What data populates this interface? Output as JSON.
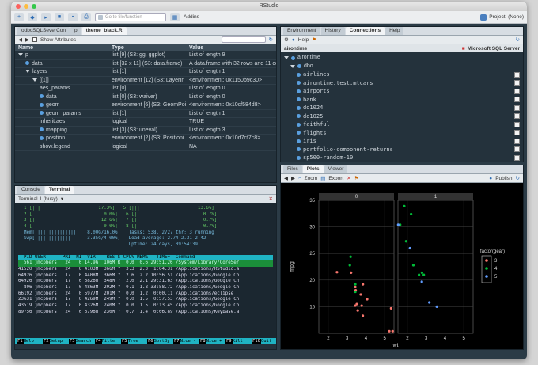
{
  "window": {
    "title": "RStudio"
  },
  "toolbar": {
    "goto_placeholder": "Go to file/function",
    "addins": "Addins",
    "project": "Project: (None)"
  },
  "source": {
    "tabs": [
      "odbcSQLSeverCon",
      "p",
      "theme_black.R"
    ],
    "show_attributes": "Show Attributes",
    "headers": [
      "Name",
      "Type",
      "Value"
    ],
    "rows": [
      {
        "name": "p",
        "type": "list [9] (S3: gg, ggplot)",
        "value": "List of length 9",
        "indent": 0,
        "mark": "tri"
      },
      {
        "name": "data",
        "type": "list [32 x 11] (S3: data.frame)",
        "value": "A data.frame with 32 rows and 11 col.",
        "indent": 1,
        "mark": "dot"
      },
      {
        "name": "layers",
        "type": "list [1]",
        "value": "List of length 1",
        "indent": 1,
        "mark": "tri"
      },
      {
        "name": "[[1]]",
        "type": "environment [12] (S3: LayerIn",
        "value": "<environment: 0x1150b9c30>",
        "indent": 2,
        "mark": "tri"
      },
      {
        "name": "aes_params",
        "type": "list [0]",
        "value": "List of length 0",
        "indent": 3,
        "mark": ""
      },
      {
        "name": "data",
        "type": "list [0] (S3: waiver)",
        "value": "List of length 0",
        "indent": 3,
        "mark": "dot"
      },
      {
        "name": "geom",
        "type": "environment [6] (S3: GeomPoi",
        "value": "<environment: 0x10cf584d8>",
        "indent": 3,
        "mark": "dot"
      },
      {
        "name": "geom_params",
        "type": "list [1]",
        "value": "List of length 1",
        "indent": 3,
        "mark": "dot"
      },
      {
        "name": "inherit.aes",
        "type": "logical",
        "value": "TRUE",
        "indent": 3,
        "mark": ""
      },
      {
        "name": "mapping",
        "type": "list [3] (S3: uneval)",
        "value": "List of length 3",
        "indent": 3,
        "mark": "dot"
      },
      {
        "name": "position",
        "type": "environment [2] (S3: Positioni",
        "value": "<environment: 0x10d7cf7c8>",
        "indent": 3,
        "mark": "dot"
      },
      {
        "name": "show.legend",
        "type": "logical",
        "value": "NA",
        "indent": 3,
        "mark": ""
      }
    ]
  },
  "env": {
    "tabs": [
      "Environment",
      "History",
      "Connections",
      "Help"
    ],
    "help": "Help",
    "conn_name": "airontime",
    "server": "Microsoft SQL Server",
    "root": "airontime",
    "schema": "dbo",
    "tables": [
      "airlines",
      "airontime.test.mtcars",
      "airports",
      "bank",
      "dd1024",
      "dd1025",
      "faithful",
      "flights",
      "iris",
      "portfolio-component-returns",
      "sp500-random-10"
    ]
  },
  "console": {
    "tabs": [
      "Console",
      "Terminal"
    ],
    "term_select": "Terminal 1 (busy)",
    "lines": [
      "  1 [|||                     17.3%]   5 [|||                     13.6%]",
      "  2 [                          0.0%]   6 [|                        0.7%]",
      "  3 [|                        12.6%]   7 [|                        0.7%]",
      "  4 [                          0.0%]   8 [|                        0.7%]",
      "  Mem[|||||||||||||||    8.00G/16.0G]   Tasks: 538, 2727 thr; 3 running",
      "  Swp[|||||||||||||      3.35G/4.00G]   Load average: 2.74 2.31 2.42",
      "                                        Uptime: 24 days, 09:54:39",
      "",
      "  PID USER      PRI  NI  VIRT   RES S CPU% MEM%   TIME+  Command",
      "  561 jmcphers   24   0 14.9G  106M R  0.0  0.6 29:51.26 /System/Library/CoreSer",
      "41520 jmcphers   24   0 4103M  366M ?  3.3  2.3  1:04.31 /Applications/RStudio.a",
      "64926 jmcphers   17   0 4408M  366M ?  2.6  2.2 10:56.51 /Applications/Google Ch",
      "64926 jmcphers   17   0 3826M  348M ?  2.0  2.1 29:31.63 /Applications/Google Ch",
      "  896 jmcphers   17   0 4863M  292M ?  0.1  1.8 33:58.72 /Applications/Google Ch",
      "66192 jmcphers   24   0 5977M  201M ?  0.0  1.2  0:00.11 /Applications/eclipse",
      "23631 jmcphers   17   0 4269M  249M ?  0.0  1.5  0:57.53 /Applications/Google Ch",
      "43519 jmcphers   17   0 4326M  240M ?  0.0  1.5  0:13.45 /Applications/Google Ch",
      "89756 jmcphers   24   0 3796M  230M ?  0.7  1.4  0:06.89 /Applications/Keybase.a"
    ],
    "fkeys": [
      [
        "F1",
        "Help"
      ],
      [
        "F2",
        "Setup"
      ],
      [
        "F3",
        "Search"
      ],
      [
        "F4",
        "Filter"
      ],
      [
        "F5",
        "Tree"
      ],
      [
        "F6",
        "SortBy"
      ],
      [
        "F7",
        "Nice -"
      ],
      [
        "F8",
        "Nice +"
      ],
      [
        "F9",
        "Kill"
      ],
      [
        "F10",
        "Quit"
      ]
    ]
  },
  "plots": {
    "tabs": [
      "Files",
      "Plots",
      "Viewer"
    ],
    "zoom": "Zoom",
    "export": "Export",
    "publish": "Publish",
    "chart_data": {
      "type": "scatter",
      "xlabel": "wt",
      "ylabel": "mpg",
      "facets": [
        "0",
        "1"
      ],
      "xlim": [
        1.5,
        5.5
      ],
      "ylim": [
        10,
        35
      ],
      "xticks": [
        2,
        3,
        4,
        5
      ],
      "yticks": [
        15,
        20,
        25,
        30,
        35
      ],
      "legend_title": "factor(gear)",
      "legend": [
        {
          "name": "3",
          "color": "#f8766d"
        },
        {
          "name": "4",
          "color": "#00ba38"
        },
        {
          "name": "5",
          "color": "#619cff"
        }
      ],
      "points": [
        {
          "f": 0,
          "g": "3",
          "x": 3.215,
          "y": 21.4
        },
        {
          "f": 0,
          "g": "3",
          "x": 3.44,
          "y": 18.7
        },
        {
          "f": 0,
          "g": "3",
          "x": 3.46,
          "y": 18.1
        },
        {
          "f": 0,
          "g": "3",
          "x": 3.57,
          "y": 14.3
        },
        {
          "f": 0,
          "g": "3",
          "x": 4.07,
          "y": 16.4
        },
        {
          "f": 0,
          "g": "3",
          "x": 3.73,
          "y": 17.3
        },
        {
          "f": 0,
          "g": "3",
          "x": 3.78,
          "y": 15.2
        },
        {
          "f": 0,
          "g": "3",
          "x": 5.25,
          "y": 10.4
        },
        {
          "f": 0,
          "g": "3",
          "x": 5.424,
          "y": 10.4
        },
        {
          "f": 0,
          "g": "3",
          "x": 5.345,
          "y": 14.7
        },
        {
          "f": 0,
          "g": "3",
          "x": 2.465,
          "y": 21.5
        },
        {
          "f": 0,
          "g": "3",
          "x": 3.52,
          "y": 15.5
        },
        {
          "f": 0,
          "g": "3",
          "x": 3.435,
          "y": 15.2
        },
        {
          "f": 0,
          "g": "3",
          "x": 3.84,
          "y": 13.3
        },
        {
          "f": 0,
          "g": "3",
          "x": 3.845,
          "y": 19.2
        },
        {
          "f": 0,
          "g": "4",
          "x": 3.19,
          "y": 24.4
        },
        {
          "f": 0,
          "g": "4",
          "x": 3.15,
          "y": 22.8
        },
        {
          "f": 0,
          "g": "4",
          "x": 3.44,
          "y": 19.2
        },
        {
          "f": 0,
          "g": "4",
          "x": 3.44,
          "y": 17.8
        },
        {
          "f": 1,
          "g": "4",
          "x": 2.62,
          "y": 21.0
        },
        {
          "f": 1,
          "g": "4",
          "x": 2.875,
          "y": 21.0
        },
        {
          "f": 1,
          "g": "4",
          "x": 2.32,
          "y": 22.8
        },
        {
          "f": 1,
          "g": "4",
          "x": 2.2,
          "y": 32.4
        },
        {
          "f": 1,
          "g": "4",
          "x": 1.615,
          "y": 30.4
        },
        {
          "f": 1,
          "g": "4",
          "x": 1.835,
          "y": 33.9
        },
        {
          "f": 1,
          "g": "4",
          "x": 1.935,
          "y": 27.3
        },
        {
          "f": 1,
          "g": "4",
          "x": 2.78,
          "y": 21.4
        },
        {
          "f": 1,
          "g": "5",
          "x": 2.14,
          "y": 26.0
        },
        {
          "f": 1,
          "g": "5",
          "x": 1.513,
          "y": 30.4
        },
        {
          "f": 1,
          "g": "5",
          "x": 3.17,
          "y": 15.8
        },
        {
          "f": 1,
          "g": "5",
          "x": 2.77,
          "y": 19.7
        },
        {
          "f": 1,
          "g": "5",
          "x": 3.57,
          "y": 15.0
        }
      ]
    }
  }
}
